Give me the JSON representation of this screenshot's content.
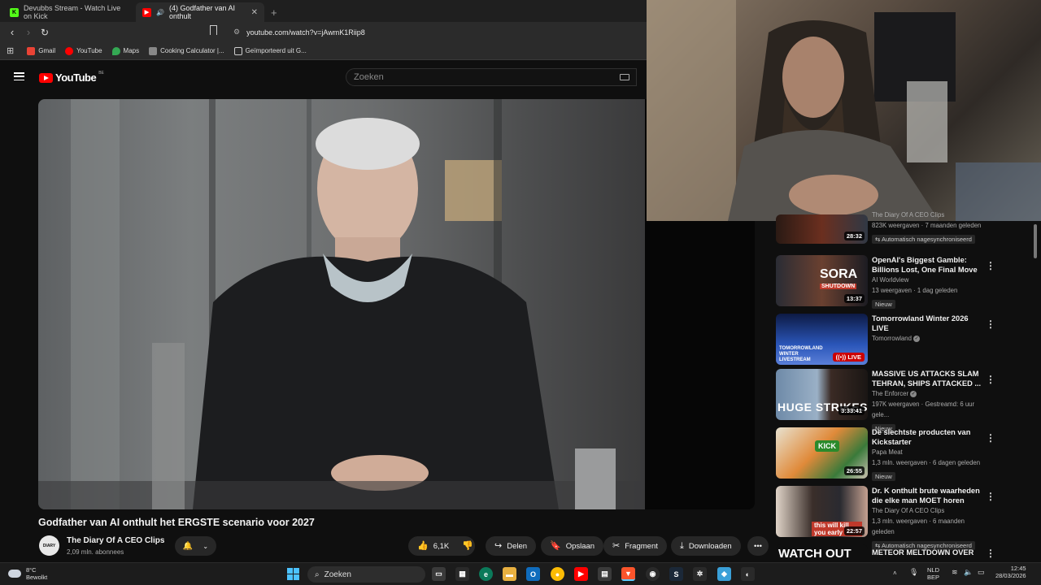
{
  "browser": {
    "tabs": [
      {
        "label": "Devubbs Stream - Watch Live on Kick",
        "favicon": "kick-icon",
        "active": false
      },
      {
        "label": "(4) Godfather van AI onthult",
        "favicon": "youtube-icon",
        "active": true
      }
    ],
    "new_tab": "+",
    "url": "youtube.com/watch?v=jAwmK1Riip8",
    "bookmarks": [
      {
        "label": "Gmail",
        "icon": "gmail-icon",
        "color": "#ea4335"
      },
      {
        "label": "YouTube",
        "icon": "youtube-icon",
        "color": "#ff0000"
      },
      {
        "label": "Maps",
        "icon": "maps-icon",
        "color": "#34a853"
      },
      {
        "label": "Cooking Calculator |...",
        "icon": "cooking-icon",
        "color": "#888888"
      },
      {
        "label": "Geïmporteerd uit G...",
        "icon": "folder-icon",
        "color": "#cccccc"
      }
    ]
  },
  "youtube": {
    "logo_text": "YouTube",
    "country": "BE",
    "search_placeholder": "Zoeken"
  },
  "video": {
    "title": "Godfather van AI onthult het ERGSTE scenario voor 2027",
    "channel": "The Diary Of A CEO Clips",
    "channel_avatar_text": "DIARY",
    "subscribers": "2,09 mln. abonnees",
    "likes": "6,1K",
    "actions": {
      "share": "Delen",
      "save": "Opslaan",
      "clip": "Fragment",
      "download": "Downloaden"
    }
  },
  "sidebar": {
    "items": [
      {
        "title": "The Diary Of A CEO Clips",
        "meta": "823K weergaven · 7 maanden geleden",
        "badge": "Automatisch nagesynchroniseerd",
        "duration": "28:32",
        "thumb_text": ""
      },
      {
        "title": "OpenAI's Biggest Gamble: Billions Lost, One Final Move",
        "channel": "AI Worldview",
        "meta": "13 weergaven · 1 dag geleden",
        "badge": "Nieuw",
        "duration": "13:37",
        "thumb_text": "SORA",
        "thumb_sub": "SHUTDOWN"
      },
      {
        "title": "Tomorrowland Winter 2026 LIVE",
        "channel": "Tomorrowland",
        "meta": "",
        "badge": "",
        "duration": "LIVE",
        "thumb_text": "TOMORROWLAND WINTER LIVESTREAM"
      },
      {
        "title": "MASSIVE US ATTACKS SLAM TEHRAN, SHIPS ATTACKED ...",
        "channel": "The Enforcer",
        "meta": "197K weergaven · Gestreamd: 6 uur gele...",
        "badge": "Nieuw",
        "duration": "3:33:41",
        "thumb_text": "HUGE STRIKES"
      },
      {
        "title": "De slechtste producten van Kickstarter",
        "channel": "Papa Meat",
        "meta": "1,3 mln. weergaven · 6 dagen geleden",
        "badge": "Nieuw",
        "duration": "26:55",
        "thumb_text": "KICK"
      },
      {
        "title": "Dr. K onthult brute waarheden die elke man MOET horen",
        "channel": "The Diary Of A CEO Clips",
        "meta": "1,3 mln. weergaven · 6 maanden geleden",
        "badge": "Automatisch nagesynchroniseerd",
        "duration": "22:57",
        "thumb_text": "this will kill you early"
      },
      {
        "title": "METEOR MELTDOWN OVER",
        "channel": "",
        "meta": "",
        "badge": "",
        "duration": "",
        "thumb_text": "WATCH OUT"
      }
    ]
  },
  "taskbar": {
    "weather_temp": "8°C",
    "weather_desc": "Bewolkt",
    "search_label": "Zoeken",
    "lang_top": "NLD",
    "lang_bottom": "BEP",
    "time": "12:45",
    "date": "28/03/2026"
  }
}
